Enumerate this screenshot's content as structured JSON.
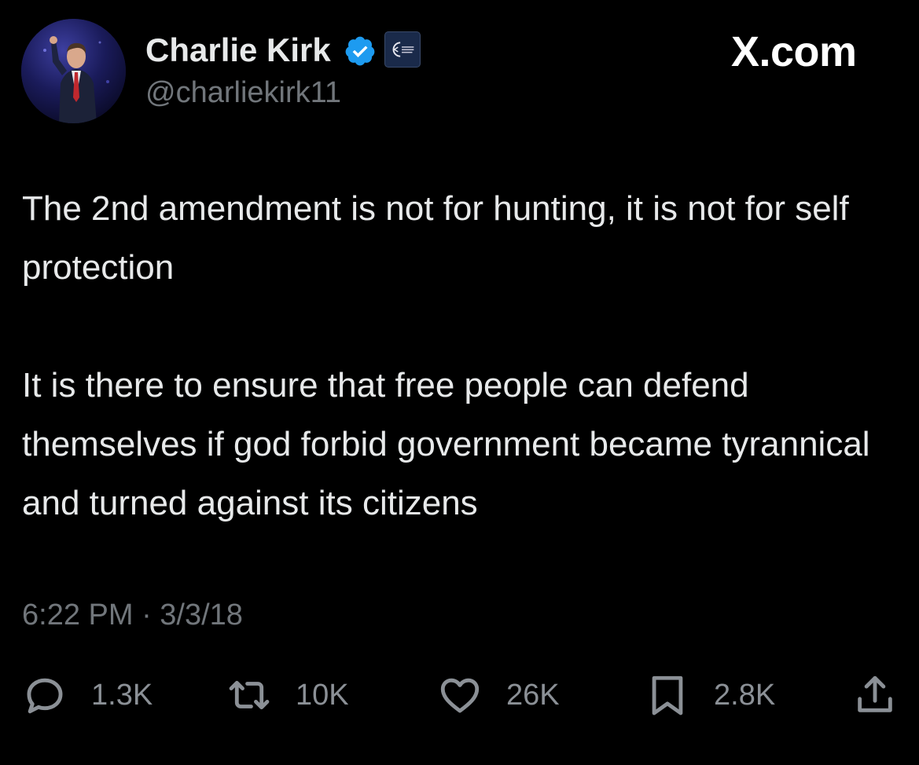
{
  "author": {
    "display_name": "Charlie Kirk",
    "handle": "@charliekirk11",
    "avatar_icon": "profile-photo",
    "verified_icon": "verified-badge-icon",
    "affiliate_icon": "organization-badge-icon"
  },
  "site": {
    "mark": "X.com"
  },
  "tweet": {
    "paragraphs": [
      "The 2nd amendment is not for hunting, it is not for self protection",
      "It is there to ensure that free people can defend themselves if god forbid government became tyrannical and turned against its citizens"
    ],
    "timestamp": "6:22 PM · 3/3/18"
  },
  "actions": {
    "reply": {
      "icon": "reply-icon",
      "count": "1.3K"
    },
    "repost": {
      "icon": "repost-icon",
      "count": "10K"
    },
    "like": {
      "icon": "like-icon",
      "count": "26K"
    },
    "bookmark": {
      "icon": "bookmark-icon",
      "count": "2.8K"
    },
    "share": {
      "icon": "share-icon"
    }
  },
  "colors": {
    "background": "#000000",
    "primary_text": "#e7e9ea",
    "secondary_text": "#71767b",
    "verified_blue": "#1d9bf0"
  }
}
